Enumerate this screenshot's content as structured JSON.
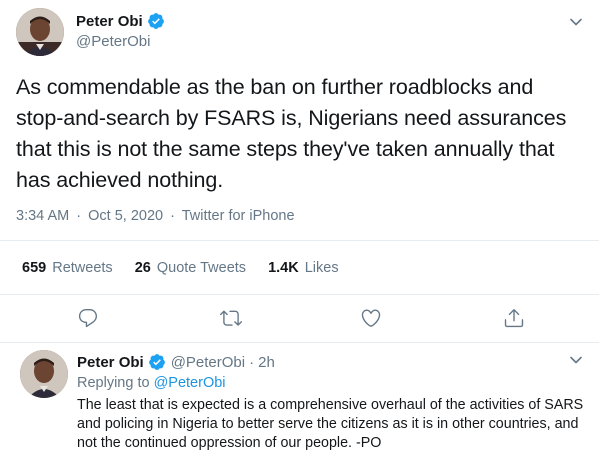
{
  "main_tweet": {
    "author_name": "Peter Obi",
    "handle": "@PeterObi",
    "text": "As commendable as the ban on further roadblocks and stop-and-search by FSARS is, Nigerians need assurances that this is not the same steps they've taken annually that has achieved nothing.",
    "time": "3:34 AM",
    "date": "Oct 5, 2020",
    "source": "Twitter for iPhone",
    "separator": "·",
    "stats": {
      "retweets_count": "659",
      "retweets_label": "Retweets",
      "quotes_count": "26",
      "quotes_label": "Quote Tweets",
      "likes_count": "1.4K",
      "likes_label": "Likes"
    }
  },
  "reply_tweet": {
    "author_name": "Peter Obi",
    "handle": "@PeterObi",
    "separator": "·",
    "age": "2h",
    "replying_label": "Replying to",
    "replying_handle": "@PeterObi",
    "text": "The least that is expected is a comprehensive overhaul of the activities of SARS and policing in Nigeria to better serve the citizens as it is in other countries, and not the continued oppression of our people. -PO"
  },
  "icons": {
    "verified": "verified-badge-icon",
    "caret": "chevron-down-icon",
    "reply": "reply-icon",
    "retweet": "retweet-icon",
    "like": "heart-icon",
    "share": "share-icon"
  },
  "colors": {
    "accent": "#1da1f2",
    "link": "#1b95e0",
    "secondary_text": "#657786",
    "border": "#e6ecf0"
  }
}
